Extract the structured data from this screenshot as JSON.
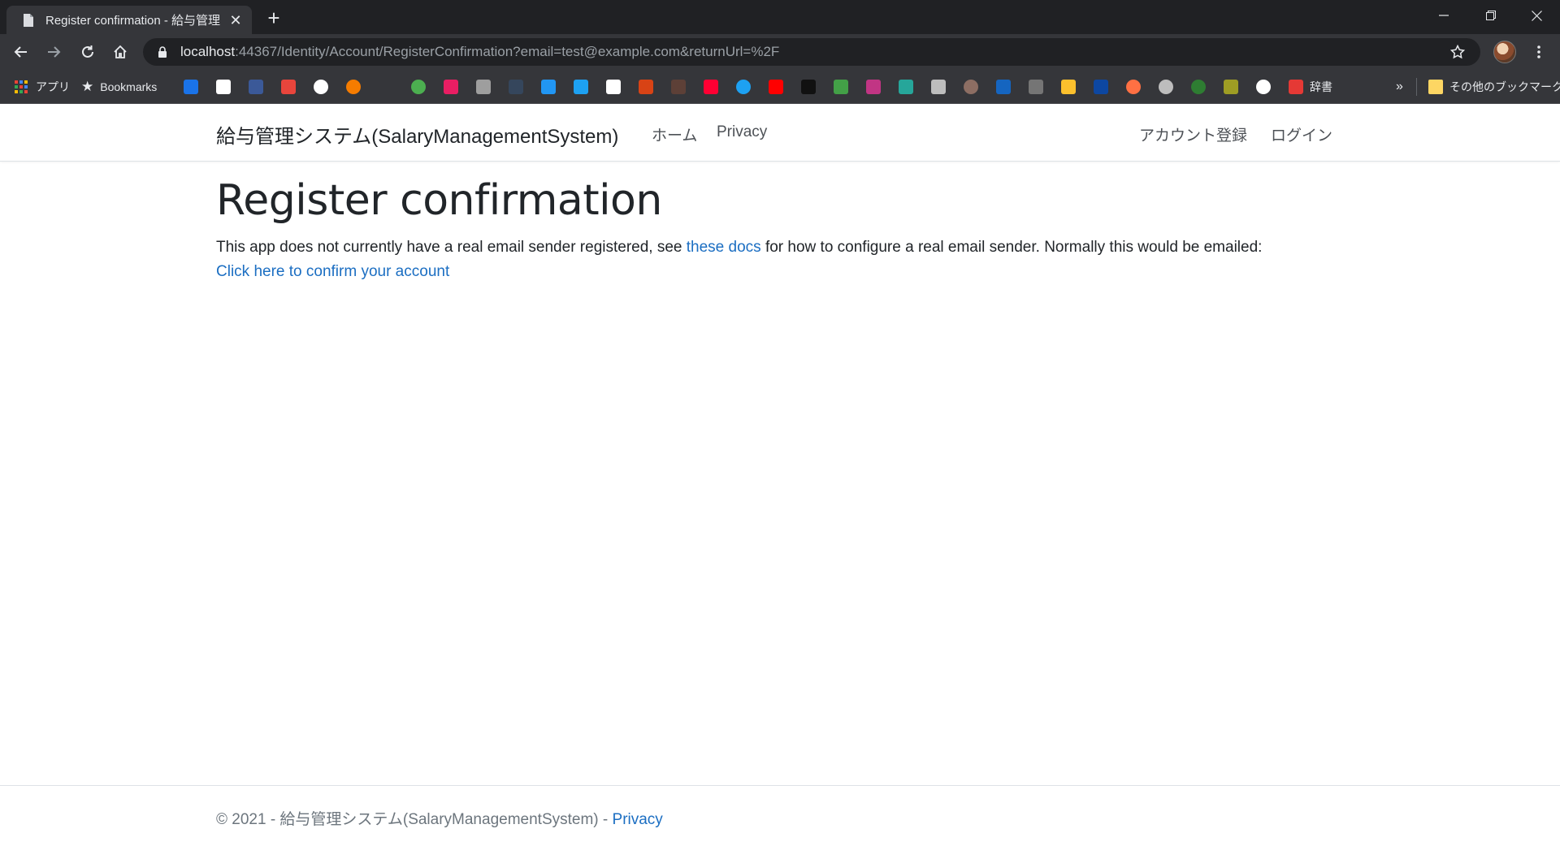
{
  "browser": {
    "tab_title": "Register confirmation - 給与管理",
    "new_tab_symbol": "+",
    "close_symbol": "✕",
    "url_host": "localhost",
    "url_rest": ":44367/Identity/Account/RegisterConfirmation?email=test@example.com&returnUrl=%2F",
    "bookmarks": {
      "apps_label": "アプリ",
      "bookmarks_label": "Bookmarks",
      "dictionary_label": "辞書",
      "overflow_label": "»",
      "other_label": "その他のブックマーク"
    },
    "colors": {
      "tabbar": "#202124",
      "toolbar": "#35363a",
      "text": "#e8eaed"
    }
  },
  "navbar": {
    "brand": "給与管理システム(SalaryManagementSystem)",
    "links": [
      "ホーム",
      "Privacy"
    ],
    "right_links": [
      "アカウント登録",
      "ログイン"
    ]
  },
  "main": {
    "heading": "Register confirmation",
    "text_before": "This app does not currently have a real email sender registered, see ",
    "docs_link": "these docs",
    "text_after": " for how to configure a real email sender. Normally this would be emailed: ",
    "confirm_link": "Click here to confirm your account"
  },
  "footer": {
    "copyright": "© 2021 - 給与管理システム(SalaryManagementSystem) - ",
    "privacy_link": "Privacy"
  },
  "colors": {
    "link": "#1b6ec2",
    "text": "#212529",
    "muted": "#6c757d"
  }
}
